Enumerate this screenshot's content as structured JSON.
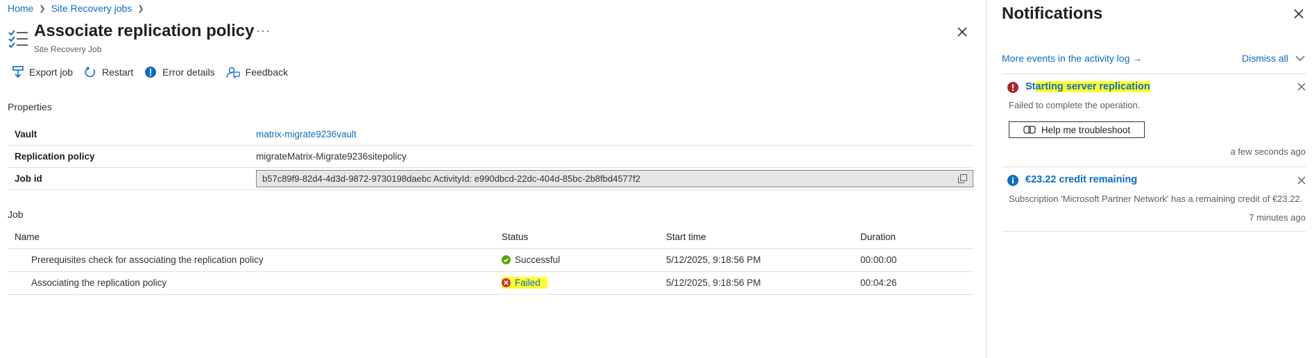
{
  "breadcrumb": {
    "home": "Home",
    "parent": "Site Recovery jobs"
  },
  "header": {
    "title": "Associate replication policy",
    "subtitle": "Site Recovery Job",
    "more": "···"
  },
  "toolbar": {
    "export": "Export job",
    "restart": "Restart",
    "error_details": "Error details",
    "feedback": "Feedback"
  },
  "properties": {
    "heading": "Properties",
    "rows": [
      {
        "key": "Vault",
        "value": "matrix-migrate9236vault"
      },
      {
        "key": "Replication policy",
        "value": "migrateMatrix-Migrate9236sitepolicy"
      },
      {
        "key": "Job id",
        "value": "b57c89f9-82d4-4d3d-9872-9730198daebc ActivityId: e990dbcd-22dc-404d-85bc-2b8fbd4577f2"
      }
    ]
  },
  "job": {
    "heading": "Job",
    "columns": [
      "Name",
      "Status",
      "Start time",
      "Duration"
    ],
    "rows": [
      {
        "name": "Prerequisites check for associating the replication policy",
        "status": "Successful",
        "start": "5/12/2025, 9:18:56 PM",
        "duration": "00:00:00"
      },
      {
        "name": "Associating the replication policy",
        "status": "Failed",
        "start": "5/12/2025, 9:18:56 PM",
        "duration": "00:04:26"
      }
    ]
  },
  "notifications": {
    "title": "Notifications",
    "activity_link": "More events in the activity log →",
    "dismiss_all": "Dismiss all",
    "items": [
      {
        "title": "Starting server replication",
        "body": "Failed to complete the operation.",
        "button": "Help me troubleshoot",
        "time": "a few seconds ago",
        "icon": "error-icon"
      },
      {
        "title": "€23.22 credit remaining",
        "body": "Subscription 'Microsoft Partner Network' has a remaining credit of €23.22.",
        "time": "7 minutes ago",
        "icon": "info-icon"
      }
    ]
  },
  "colors": {
    "link": "#0f6cbd",
    "error": "#a4262c",
    "success": "#57a300",
    "highlight": "#ffff33"
  }
}
